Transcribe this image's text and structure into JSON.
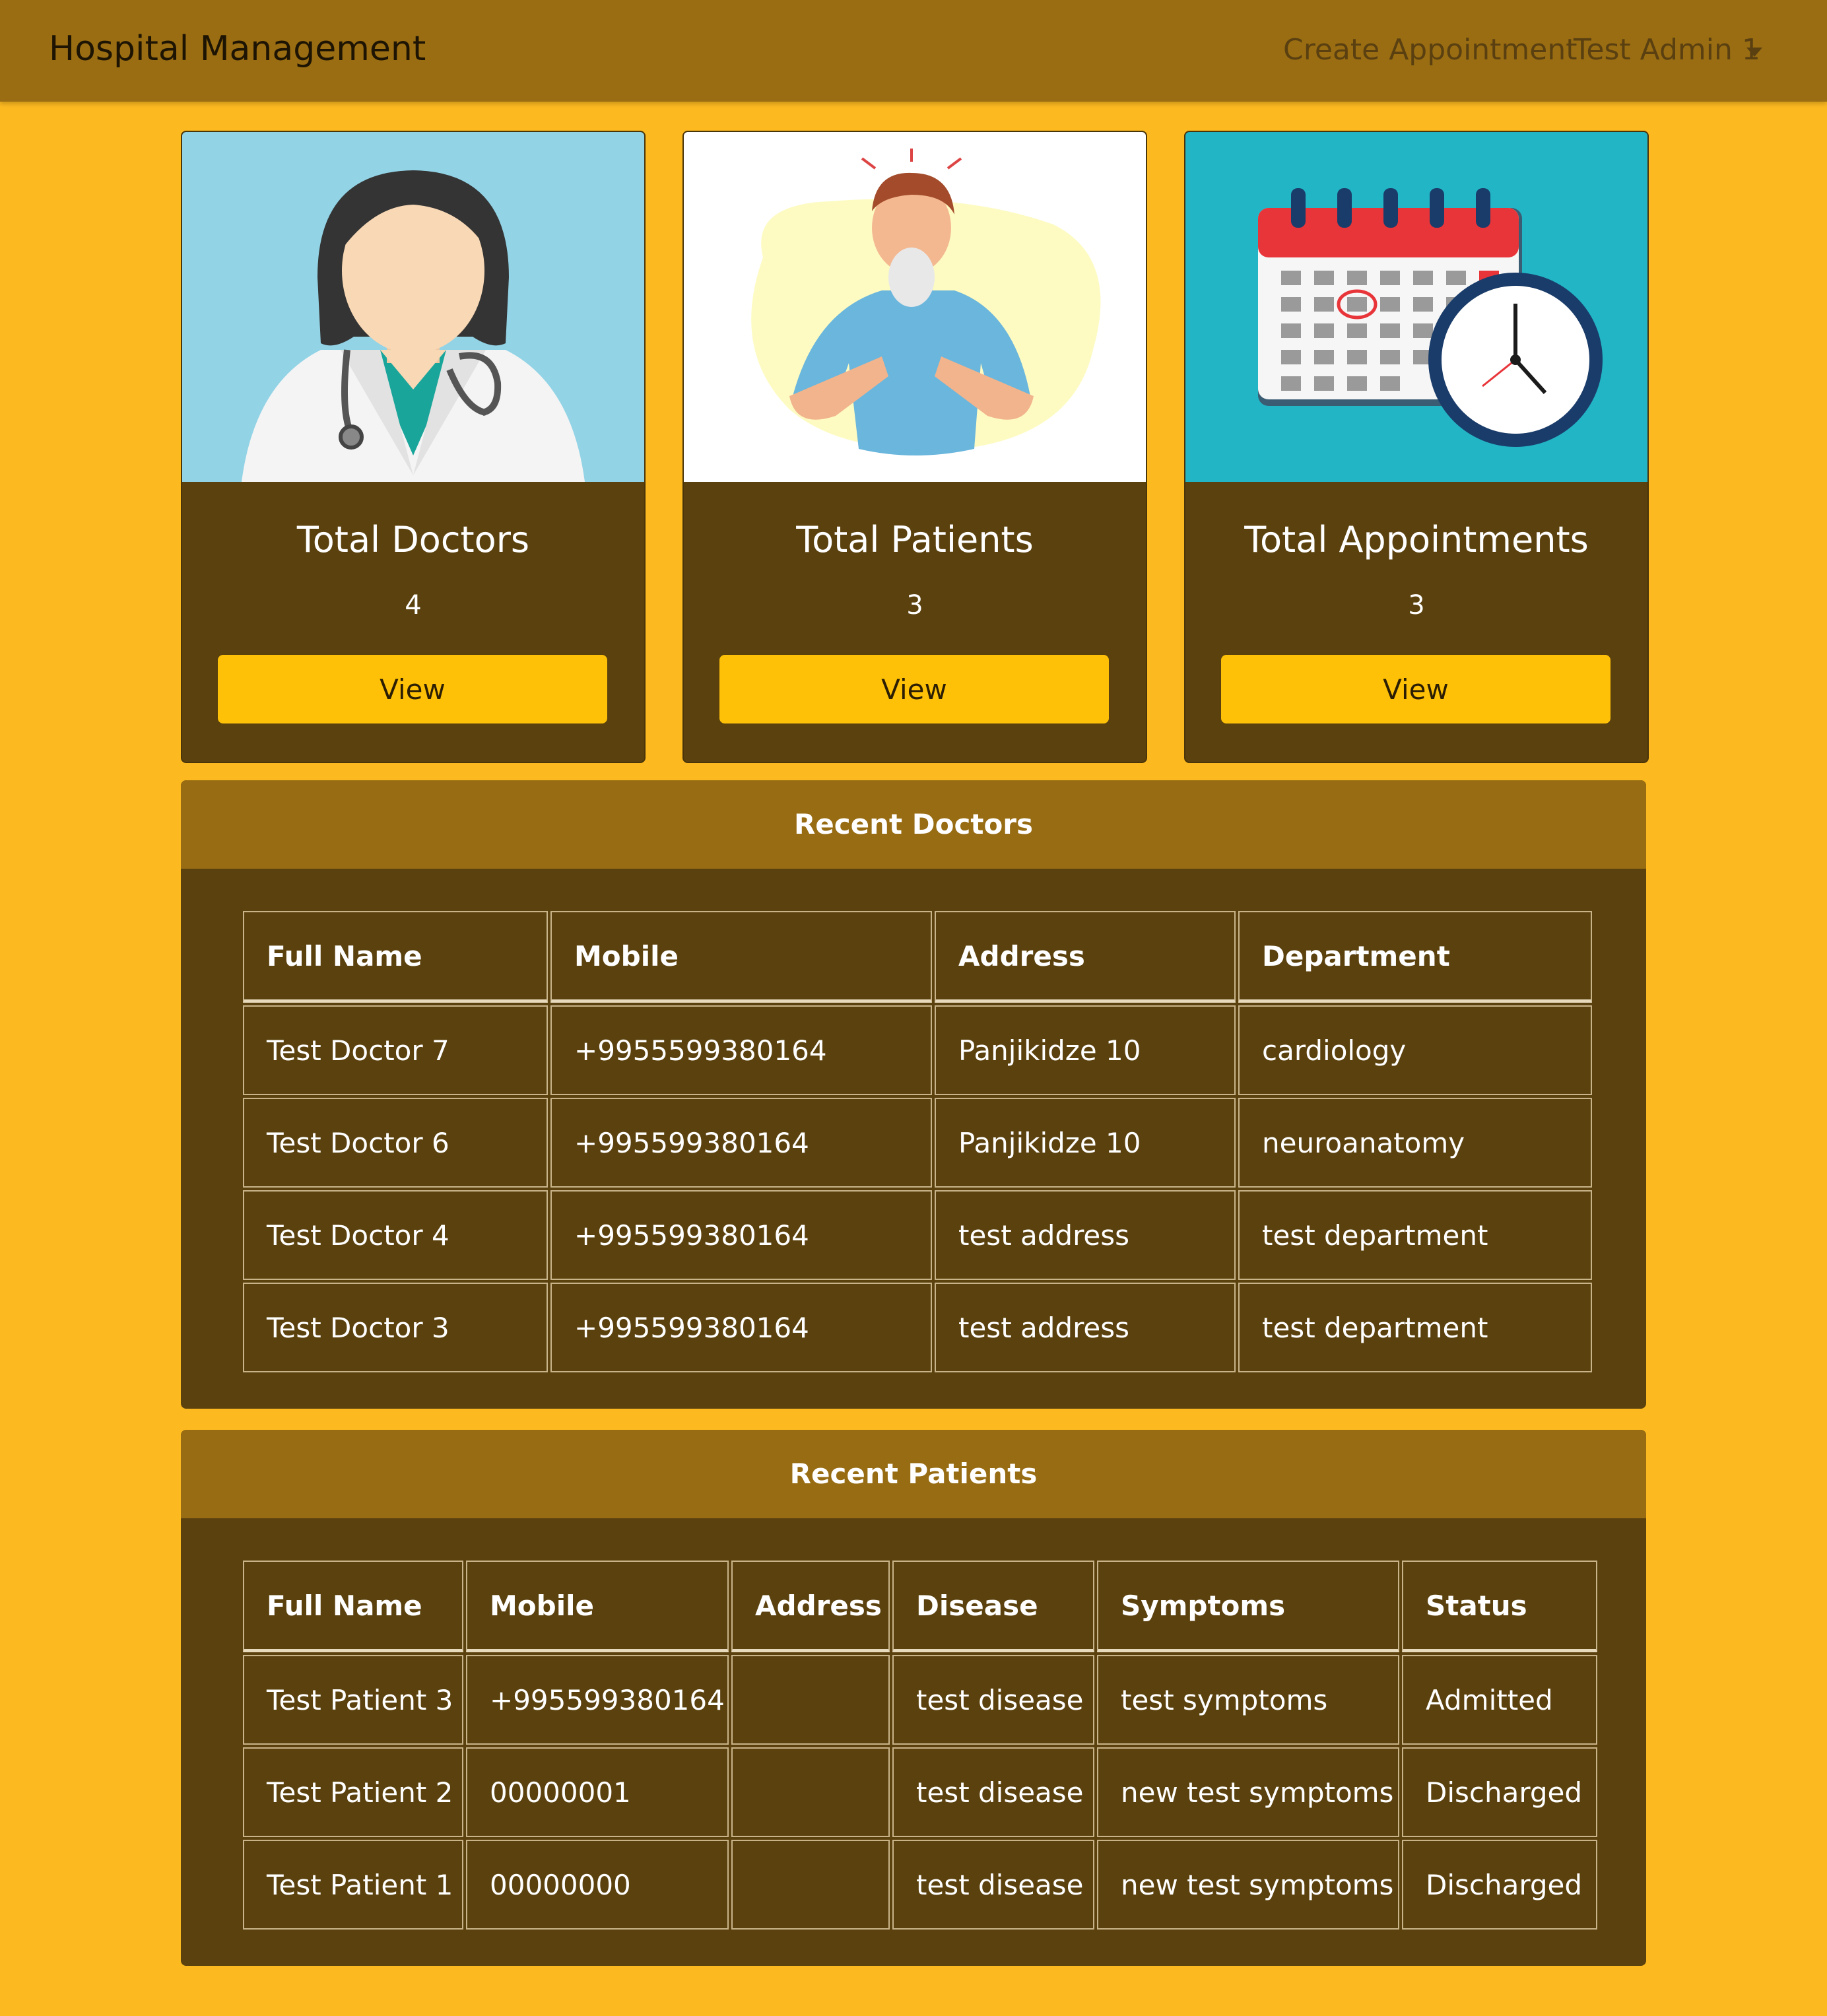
{
  "nav": {
    "brand": "Hospital Management",
    "create_appointment": "Create Appointment",
    "user": "Test Admin 1"
  },
  "cards": [
    {
      "title": "Total Doctors",
      "count": "4",
      "button": "View",
      "image": "doctor-illustration"
    },
    {
      "title": "Total Patients",
      "count": "3",
      "button": "View",
      "image": "patient-illustration"
    },
    {
      "title": "Total Appointments",
      "count": "3",
      "button": "View",
      "image": "calendar-clock-illustration"
    }
  ],
  "recent_doctors": {
    "title": "Recent Doctors",
    "columns": [
      "Full Name",
      "Mobile",
      "Address",
      "Department"
    ],
    "rows": [
      [
        "Test Doctor 7",
        "+9955599380164",
        "Panjikidze 10",
        "cardiology"
      ],
      [
        "Test Doctor 6",
        "+995599380164",
        "Panjikidze 10",
        "neuroanatomy"
      ],
      [
        "Test Doctor 4",
        "+995599380164",
        "test address",
        "test department"
      ],
      [
        "Test Doctor 3",
        "+995599380164",
        "test address",
        "test department"
      ]
    ]
  },
  "recent_patients": {
    "title": "Recent Patients",
    "columns": [
      "Full Name",
      "Mobile",
      "Address",
      "Disease",
      "Symptoms",
      "Status"
    ],
    "rows": [
      [
        "Test Patient 3",
        "+995599380164",
        "",
        "test disease",
        "test symptoms",
        "Admitted"
      ],
      [
        "Test Patient 2",
        "00000001",
        "",
        "test disease",
        "new test symptoms",
        "Discharged"
      ],
      [
        "Test Patient 1",
        "00000000",
        "",
        "test disease",
        "new test symptoms",
        "Discharged"
      ]
    ]
  },
  "colors": {
    "page_bg": "#fdba20",
    "navbar": "#9a6d12",
    "card_body": "#5b410e",
    "panel_header": "#976c13",
    "button": "#ffc107"
  }
}
